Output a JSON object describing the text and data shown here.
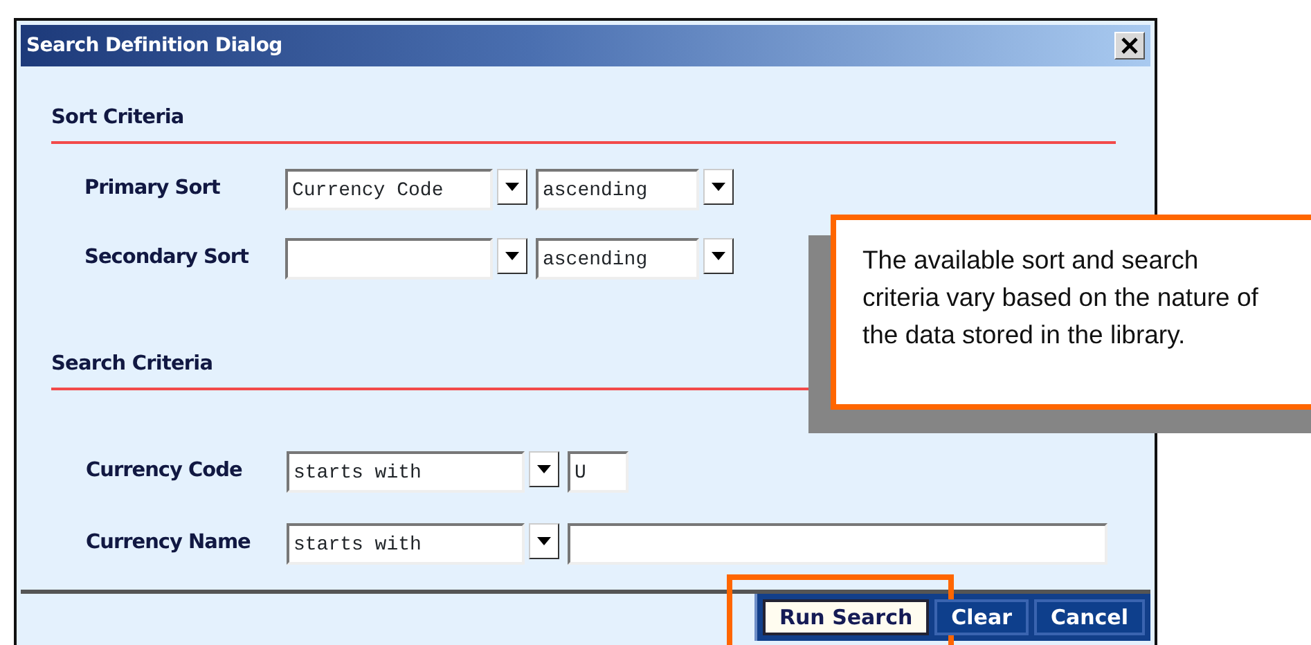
{
  "window": {
    "title": "Search Definition Dialog"
  },
  "sections": [
    {
      "heading": "Sort Criteria",
      "rows": [
        {
          "label": "Primary Sort",
          "controls": [
            {
              "kind": "combo",
              "value": "Currency Code"
            },
            {
              "kind": "combo",
              "value": "ascending"
            }
          ]
        },
        {
          "label": "Secondary Sort",
          "controls": [
            {
              "kind": "combo"
            },
            {
              "kind": "combo",
              "value": "ascending"
            }
          ]
        }
      ]
    },
    {
      "heading": "Search Criteria",
      "rows": [
        {
          "label": "Currency Code",
          "controls": [
            {
              "kind": "combo",
              "value": "starts with"
            },
            {
              "kind": "text",
              "value": "U"
            }
          ]
        },
        {
          "label": "Currency Name",
          "controls": [
            {
              "kind": "combo",
              "value": "starts with"
            },
            {
              "kind": "text"
            }
          ]
        }
      ]
    }
  ],
  "buttons": [
    {
      "label": "Run Search",
      "selected": true,
      "highlighted": true
    },
    {
      "label": "Clear",
      "selected": false,
      "highlighted": false
    },
    {
      "label": "Cancel",
      "selected": false,
      "highlighted": false
    }
  ],
  "callout": {
    "text": "The available sort and search criteria vary based on the nature of the data stored in the library."
  }
}
